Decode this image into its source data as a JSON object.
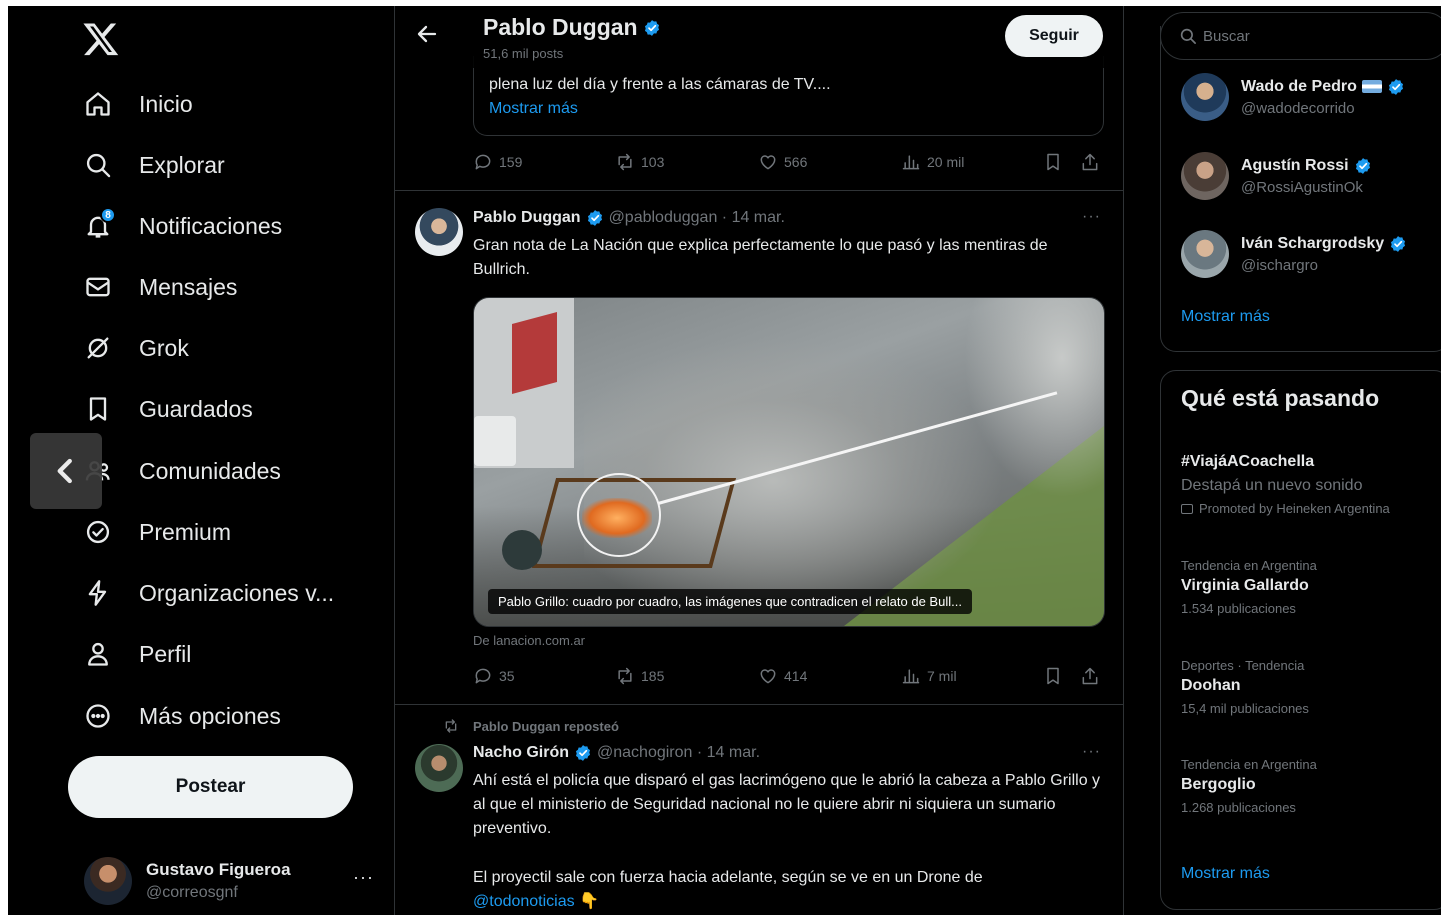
{
  "colors": {
    "accent": "#1d9bf0",
    "background": "#000000",
    "text": "#e7e9ea",
    "muted": "#71767b",
    "border": "#2f3336"
  },
  "nav": {
    "logo": "x-logo-icon",
    "items": [
      {
        "label": "Inicio",
        "icon": "home-icon"
      },
      {
        "label": "Explorar",
        "icon": "search-icon"
      },
      {
        "label": "Notificaciones",
        "icon": "bell-icon",
        "badge": "8"
      },
      {
        "label": "Mensajes",
        "icon": "envelope-icon"
      },
      {
        "label": "Grok",
        "icon": "grok-icon"
      },
      {
        "label": "Guardados",
        "icon": "bookmark-icon"
      },
      {
        "label": "Comunidades",
        "icon": "people-icon"
      },
      {
        "label": "Premium",
        "icon": "premium-icon"
      },
      {
        "label": "Organizaciones v...",
        "icon": "lightning-icon"
      },
      {
        "label": "Perfil",
        "icon": "person-icon"
      },
      {
        "label": "Más opciones",
        "icon": "more-circle-icon"
      }
    ],
    "post_button": "Postear",
    "profile": {
      "name": "Gustavo Figueroa",
      "handle": "@correosgnf",
      "more": "···"
    }
  },
  "header": {
    "title": "Pablo Duggan",
    "subtitle": "51,6 mil posts",
    "follow": "Seguir"
  },
  "feed": {
    "prev_card": {
      "text": "plena luz del día y frente a las cámaras de TV....",
      "show_more": "Mostrar más"
    },
    "prev_actions": {
      "replies": "159",
      "reposts": "103",
      "likes": "566",
      "views": "20 mil"
    },
    "tweet1": {
      "name": "Pablo Duggan",
      "meta": "@pabloduggan · 14 mar.",
      "more": "···",
      "text": "Gran nota de La Nación que explica perfectamente lo que pasó y las mentiras de Bullrich.",
      "media_caption": "Pablo Grillo: cuadro por cuadro, las imágenes que contradicen el relato de Bull...",
      "source": "De lanacion.com.ar",
      "actions": {
        "replies": "35",
        "reposts": "185",
        "likes": "414",
        "views": "7 mil"
      }
    },
    "tweet2": {
      "repost_label": "Pablo Duggan reposteó",
      "name": "Nacho Girón",
      "meta": "@nachogiron · 14 mar.",
      "more": "···",
      "text1": "Ahí está el policía que disparó el gas lacrimógeno que le abrió la cabeza a Pablo Grillo y al que el ministerio de Seguridad nacional no le quiere abrir ni siquiera un sumario preventivo.",
      "text2": "El proyectil sale con fuerza hacia adelante, según se ve en un Drone de",
      "mention": "@todonoticias",
      "emoji": "👇"
    }
  },
  "right": {
    "search_placeholder": "Buscar",
    "who_to_follow": [
      {
        "name": "Wado de Pedro",
        "handle": "@wadodecorrido"
      },
      {
        "name": "Agustín Rossi",
        "handle": "@RossiAgustinOk"
      },
      {
        "name": "Iván Schargrodsky",
        "handle": "@ischargro"
      }
    ],
    "show_more_1": "Mostrar más",
    "trends_title": "Qué está pasando",
    "trends": [
      {
        "title": "#ViajáACoachella",
        "desc": "Destapá un nuevo sonido",
        "promo": "Promoted by Heineken Argentina"
      },
      {
        "context": "Tendencia en Argentina",
        "title": "Virginia Gallardo",
        "count": "1.534 publicaciones"
      },
      {
        "context": "Deportes · Tendencia",
        "title": "Doohan",
        "count": "15,4 mil publicaciones"
      },
      {
        "context": "Tendencia en Argentina",
        "title": "Bergoglio",
        "count": "1.268 publicaciones"
      }
    ],
    "show_more_2": "Mostrar más"
  }
}
